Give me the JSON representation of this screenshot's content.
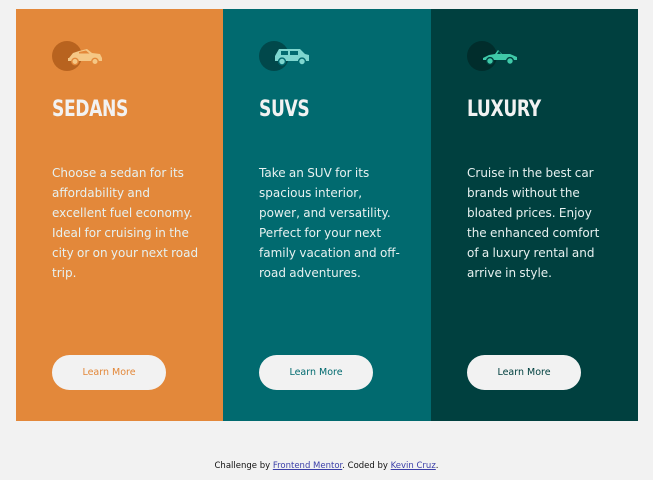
{
  "cards": [
    {
      "title": "Sedans",
      "text": "Choose a sedan for its affordability and excellent fuel economy. Ideal for cruising in the city or on your next road trip.",
      "button": "Learn More",
      "icon": "sedan-car-icon",
      "color": "#e3883a"
    },
    {
      "title": "SUVs",
      "text": "Take an SUV for its spacious interior, power, and versatility. Perfect for your next family vacation and off-road adventures.",
      "button": "Learn More",
      "icon": "suv-car-icon",
      "color": "#016a6f"
    },
    {
      "title": "Luxury",
      "text": "Cruise in the best car brands without the bloated prices. Enjoy the enhanced comfort of a luxury rental and arrive in style.",
      "button": "Learn More",
      "icon": "luxury-car-icon",
      "color": "#00403f"
    }
  ],
  "attribution": {
    "prefix": "Challenge by ",
    "link1": "Frontend Mentor",
    "middle": ". Coded by ",
    "link2": "Kevin Cruz",
    "suffix": "."
  },
  "colors": {
    "background": "#f2f2f2",
    "icon_fill": "#f5c785",
    "icon_fill_suv": "#7ed6cf",
    "icon_fill_lux": "#3fc9a8"
  }
}
